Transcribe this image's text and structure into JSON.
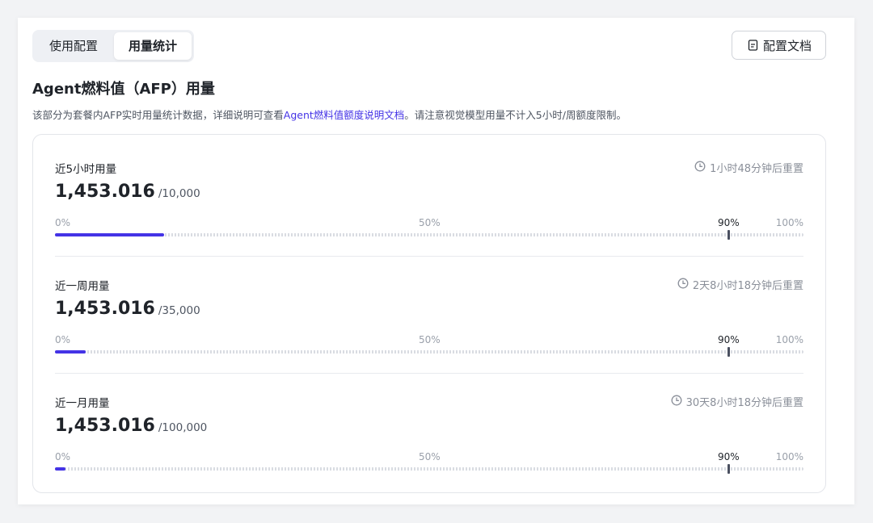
{
  "tabs": [
    {
      "label": "使用配置",
      "active": false
    },
    {
      "label": "用量统计",
      "active": true
    }
  ],
  "doc_button": {
    "label": "配置文档",
    "icon": "document-icon"
  },
  "title": "Agent燃料值（AFP）用量",
  "description": {
    "before": "该部分为套餐内AFP实时用量统计数据，详细说明可查看",
    "link": "Agent燃料值额度说明文档",
    "after": "。请注意视觉模型用量不计入5小时/周额度限制。"
  },
  "accent_color": "#4433e6",
  "sections": [
    {
      "name": "近5小时用量",
      "reset": "1小时48分钟后重置",
      "used": "1,453.016",
      "limit": "/10,000",
      "fraction": 0.1453
    },
    {
      "name": "近一周用量",
      "reset": "2天8小时18分钟后重置",
      "used": "1,453.016",
      "limit": "/35,000",
      "fraction": 0.0415
    },
    {
      "name": "近一月用量",
      "reset": "30天8小时18分钟后重置",
      "used": "1,453.016",
      "limit": "/100,000",
      "fraction": 0.0145
    }
  ],
  "ticks": {
    "t0": "0%",
    "t50": "50%",
    "t90": "90%",
    "t100": "100%"
  }
}
